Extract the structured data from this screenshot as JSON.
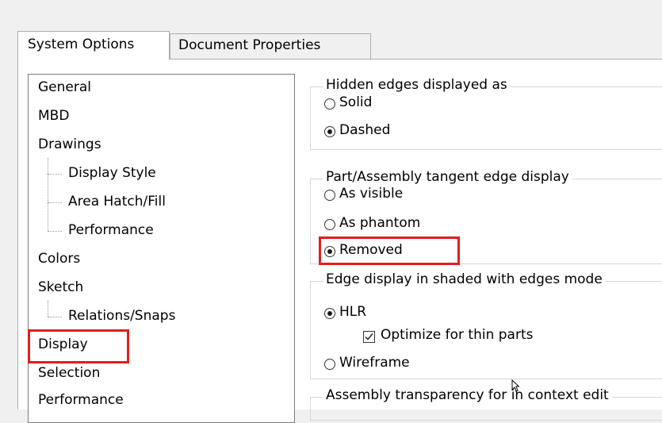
{
  "tabs": [
    {
      "label": "System Options",
      "active": true
    },
    {
      "label": "Document Properties",
      "active": false
    }
  ],
  "tree": [
    {
      "label": "General"
    },
    {
      "label": "MBD"
    },
    {
      "label": "Drawings"
    },
    {
      "label": "Display Style"
    },
    {
      "label": "Area Hatch/Fill"
    },
    {
      "label": "Performance"
    },
    {
      "label": "Colors"
    },
    {
      "label": "Sketch"
    },
    {
      "label": "Relations/Snaps"
    },
    {
      "label": "Display"
    },
    {
      "label": "Selection"
    },
    {
      "label": "Performance"
    }
  ],
  "hidden_edges": {
    "title": "Hidden edges displayed as",
    "options": [
      "Solid",
      "Dashed"
    ],
    "selected": "Dashed"
  },
  "tangent_edge": {
    "title": "Part/Assembly tangent edge display",
    "options": [
      "As visible",
      "As phantom",
      "Removed"
    ],
    "selected": "Removed"
  },
  "shaded_edges": {
    "title": "Edge display in shaded with edges mode",
    "options": [
      "HLR",
      "Wireframe"
    ],
    "selected": "HLR",
    "checkbox": {
      "label": "Optimize for thin parts",
      "checked": true
    }
  },
  "assembly_transparency": {
    "title": "Assembly transparency for in context edit"
  },
  "colors": {
    "highlight": "#e01e1e",
    "border": "#adadad"
  }
}
